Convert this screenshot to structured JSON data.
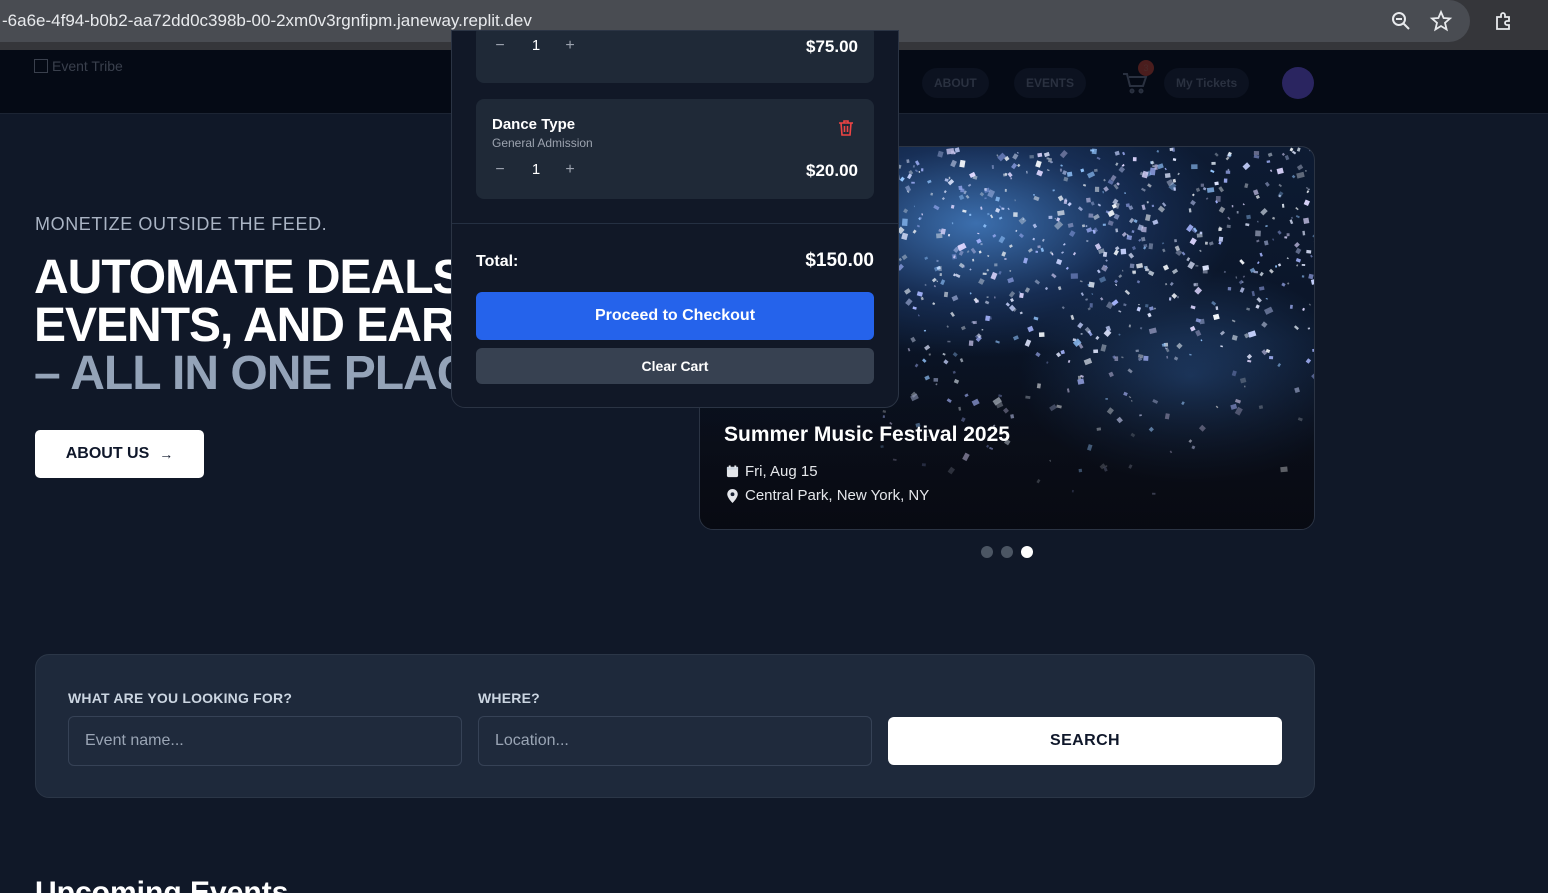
{
  "browser": {
    "url": "-6a6e-4f94-b0b2-aa72dd0c398b-00-2xm0v3rgnfipm.janeway.replit.dev",
    "icons": [
      "zoom-icon",
      "bookmark-star-icon",
      "extensions-icon"
    ]
  },
  "header": {
    "logo_alt": "Event Tribe",
    "nav": [
      "ABOUT",
      "EVENTS",
      "My Tickets"
    ],
    "cart_count": "3"
  },
  "hero": {
    "tagline": "MONETIZE OUTSIDE THE FEED.",
    "title_line1": "AUTOMATE DEALS",
    "title_line2": "EVENTS, AND EAR",
    "title_line3": "– ALL IN ONE PLAC",
    "about_label": "ABOUT US",
    "about_arrow": "→"
  },
  "carousel": {
    "event_title": "Summer Music Festival 2025",
    "date": "Fri, Aug 15",
    "location": "Central Park, New York, NY",
    "slide_count": 3,
    "active_slide": 3
  },
  "search": {
    "what_label": "WHAT ARE YOU LOOKING FOR?",
    "what_placeholder": "Event name...",
    "where_label": "WHERE?",
    "where_placeholder": "Location...",
    "button_label": "SEARCH"
  },
  "upcoming_title": "Upcoming Events",
  "cart": {
    "items": [
      {
        "qty": "1",
        "price": "$75.00",
        "minus": "−",
        "plus": "+"
      },
      {
        "name": "Dance Type",
        "type": "General Admission",
        "qty": "1",
        "price": "$20.00",
        "minus": "−",
        "plus": "+"
      }
    ],
    "total_label": "Total:",
    "total_value": "$150.00",
    "checkout_label": "Proceed to Checkout",
    "clear_label": "Clear Cart"
  },
  "colors": {
    "page_bg": "#101828",
    "primary_button": "#2563eb",
    "trash_red": "#ef4444"
  }
}
